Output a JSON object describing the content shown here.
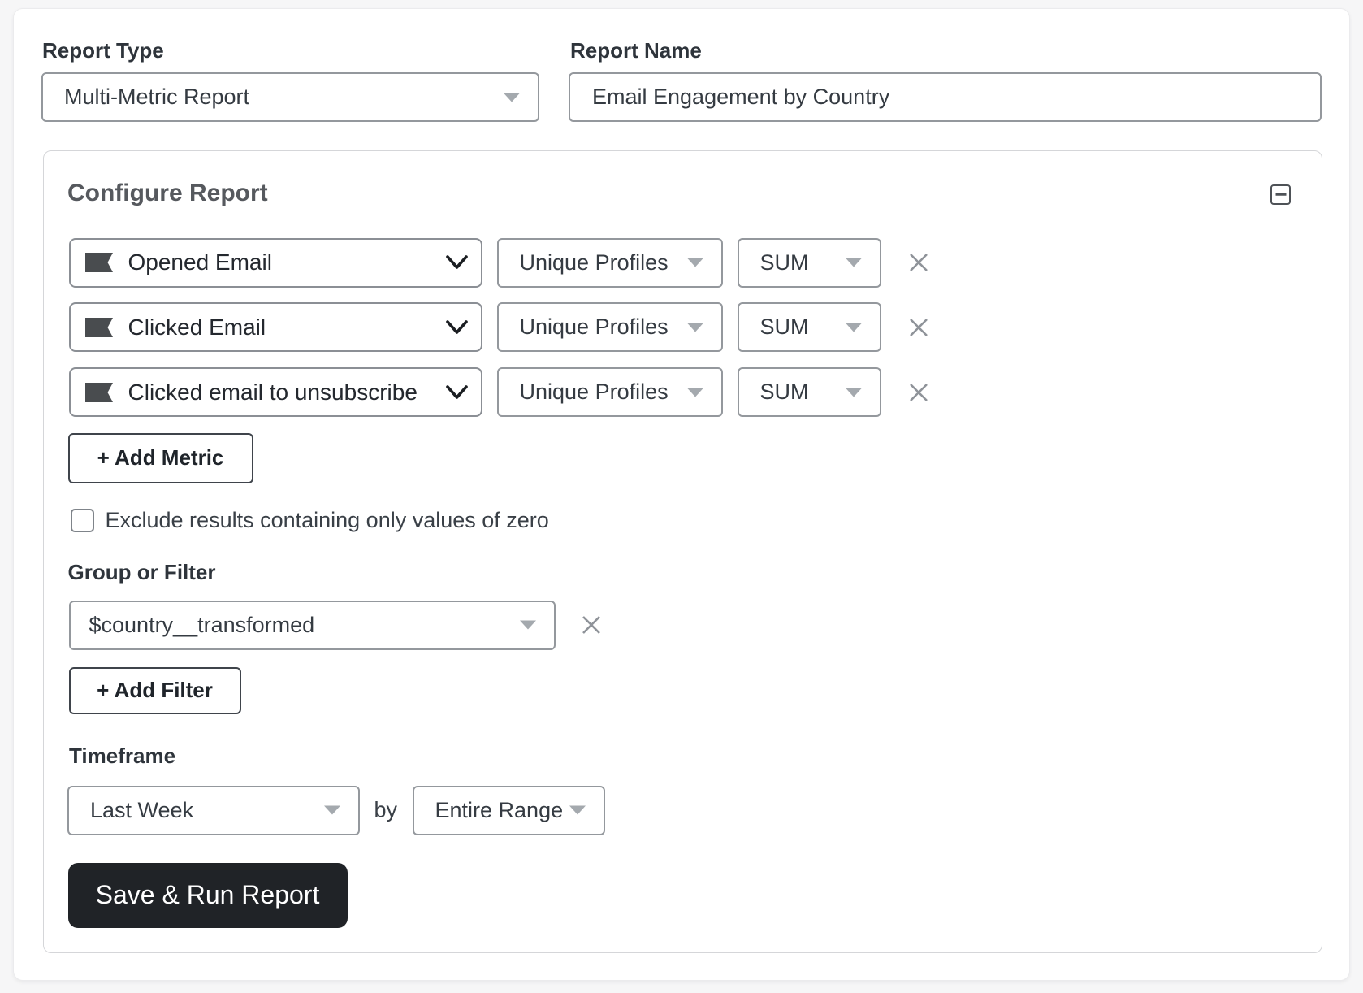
{
  "report_type": {
    "label": "Report Type",
    "value": "Multi-Metric Report"
  },
  "report_name": {
    "label": "Report Name",
    "value": "Email Engagement by Country"
  },
  "configure": {
    "title": "Configure Report",
    "metrics": [
      {
        "name": "Opened Email",
        "measurement": "Unique Profiles",
        "aggregation": "SUM"
      },
      {
        "name": "Clicked Email",
        "measurement": "Unique Profiles",
        "aggregation": "SUM"
      },
      {
        "name": "Clicked email to unsubscribe",
        "measurement": "Unique Profiles",
        "aggregation": "SUM"
      }
    ],
    "add_metric_label": "+ Add Metric",
    "exclude_zero_label": "Exclude results containing only values of zero",
    "exclude_zero_checked": false,
    "group_or_filter": {
      "label": "Group or Filter",
      "value": "$country__transformed",
      "add_filter_label": "+ Add Filter"
    },
    "timeframe": {
      "label": "Timeframe",
      "range": "Last Week",
      "by_label": "by",
      "interval": "Entire Range"
    },
    "save_button_label": "Save & Run Report"
  },
  "colors": {
    "page_background": "#f6f6f7",
    "card_background": "#ffffff",
    "input_border": "#8e9298",
    "panel_border": "#d5d6d9",
    "label_text": "#2e343b",
    "value_text": "#353b42",
    "panel_title_text": "#56595e",
    "save_button_background": "#202327",
    "save_button_text": "#ffffff",
    "icon_gray": "#8f9399",
    "flag_icon": "#42464c"
  }
}
